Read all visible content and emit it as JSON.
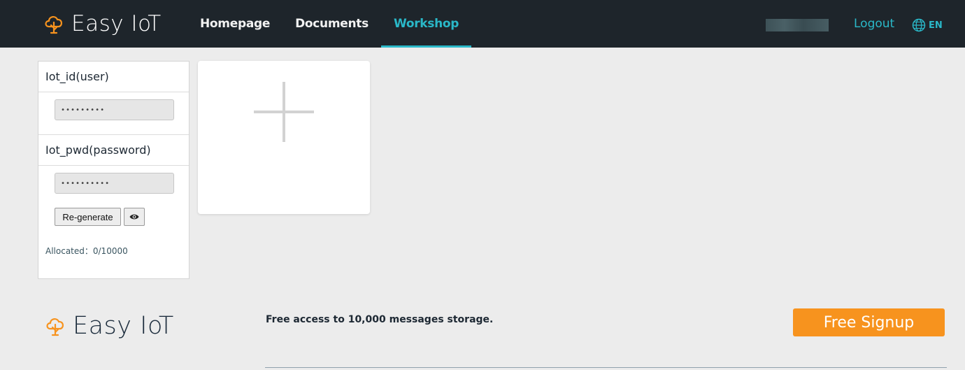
{
  "header": {
    "brand": "Easy IoT",
    "nav": [
      {
        "label": "Homepage"
      },
      {
        "label": "Documents"
      },
      {
        "label": "Workshop"
      }
    ],
    "logout": "Logout",
    "language": "EN",
    "accent_color": "#2ab8c8",
    "background_color": "#1e252b"
  },
  "credentials": {
    "id_label": "Iot_id(user)",
    "id_value": "•••••••••",
    "pwd_label": "Iot_pwd(password)",
    "pwd_value": "••••••••••",
    "regenerate_label": "Re-generate",
    "toggle_icon": "eye-icon",
    "allocated_text": "Allocated：0/10000"
  },
  "add_card": {
    "icon": "plus-icon"
  },
  "footer": {
    "brand": "Easy IoT",
    "message": "Free access to 10,000 messages storage.",
    "signup_label": "Free Signup",
    "signup_color": "#f7931e"
  }
}
